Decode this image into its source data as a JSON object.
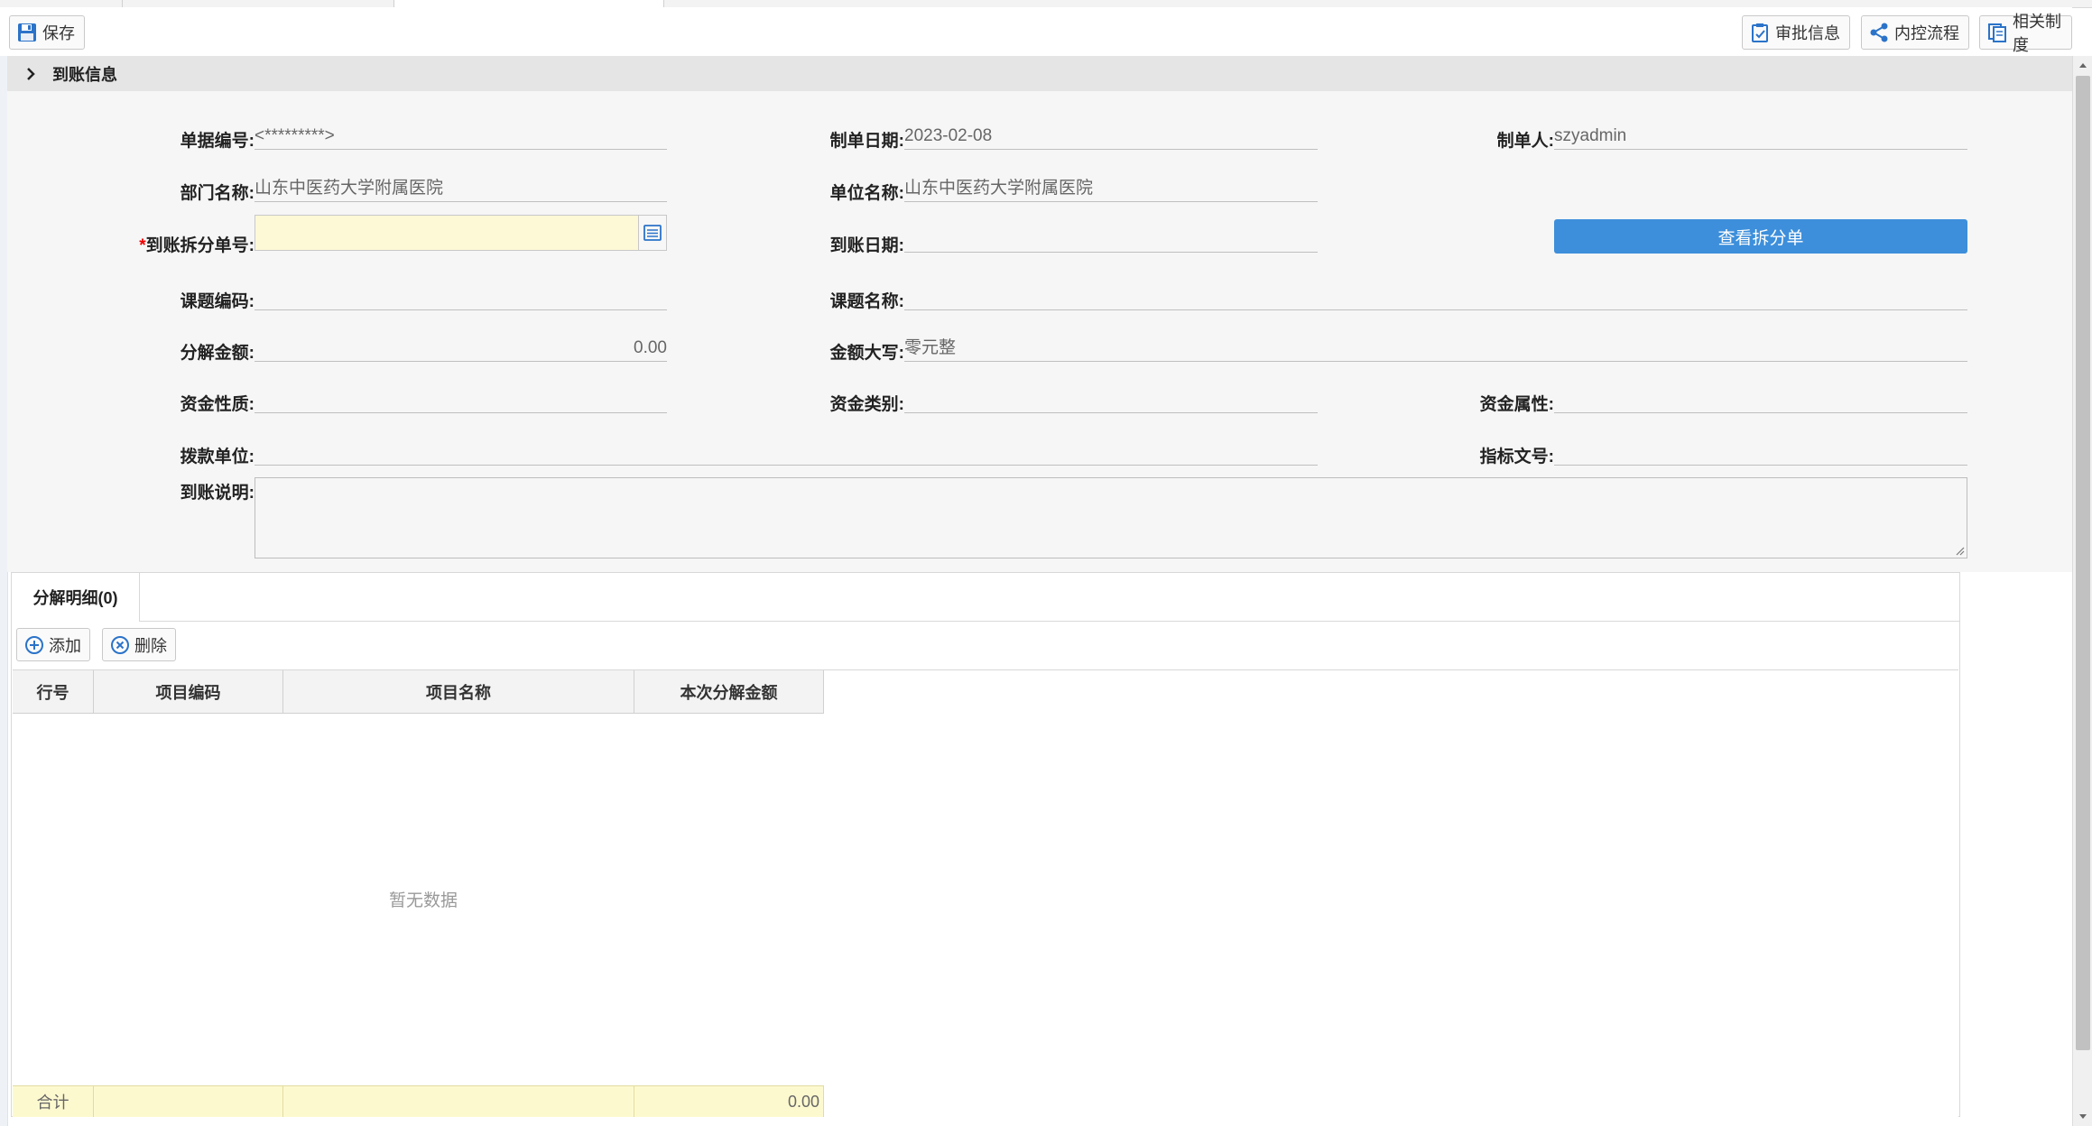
{
  "toolbar": {
    "save_label": "保存",
    "approval_label": "审批信息",
    "control_flow_label": "内控流程",
    "related_policy_label": "相关制度"
  },
  "panel": {
    "title": "到账信息"
  },
  "form": {
    "doc_no_label": "单据编号:",
    "doc_no_value": "<*********>",
    "create_date_label": "制单日期:",
    "create_date_value": "2023-02-08",
    "creator_label": "制单人:",
    "creator_value": "szyadmin",
    "dept_label": "部门名称:",
    "dept_value": "山东中医药大学附属医院",
    "unit_label": "单位名称:",
    "unit_value": "山东中医药大学附属医院",
    "split_no_required": "*",
    "split_no_label": "到账拆分单号:",
    "split_no_value": "",
    "arrival_date_label": "到账日期:",
    "arrival_date_value": "",
    "view_split_button": "查看拆分单",
    "topic_code_label": "课题编码:",
    "topic_code_value": "",
    "topic_name_label": "课题名称:",
    "topic_name_value": "",
    "split_amount_label": "分解金额:",
    "split_amount_value": "0.00",
    "amount_upper_label": "金额大写:",
    "amount_upper_value": "零元整",
    "fund_nature_label": "资金性质:",
    "fund_nature_value": "",
    "fund_category_label": "资金类别:",
    "fund_category_value": "",
    "fund_attr_label": "资金属性:",
    "fund_attr_value": "",
    "payer_unit_label": "拨款单位:",
    "payer_unit_value": "",
    "index_doc_label": "指标文号:",
    "index_doc_value": "",
    "arrival_note_label": "到账说明:",
    "arrival_note_value": ""
  },
  "detail": {
    "tab_label": "分解明细(0)",
    "add_label": "添加",
    "delete_label": "删除",
    "columns": [
      "行号",
      "项目编码",
      "项目名称",
      "本次分解金额"
    ],
    "empty_text": "暂无数据",
    "footer": {
      "label": "合计",
      "amount": "0.00"
    }
  },
  "colors": {
    "primary_button": "#3d8fdb",
    "required_input_bg": "#fdf8d6",
    "footer_bg": "#fdf9cf"
  }
}
